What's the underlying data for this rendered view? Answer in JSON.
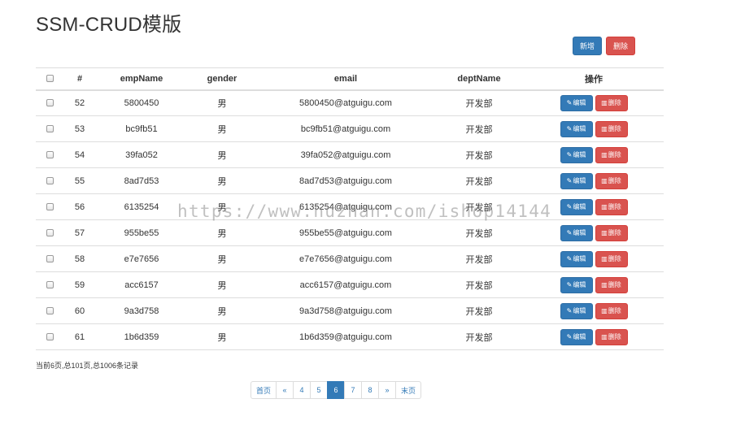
{
  "page": {
    "title": "SSM-CRUD模版"
  },
  "top_actions": {
    "add_label": "新增",
    "delete_label": "删除"
  },
  "table": {
    "headers": {
      "id": "#",
      "empName": "empName",
      "gender": "gender",
      "email": "email",
      "deptName": "deptName",
      "ops": "操作"
    },
    "edit_label": "编辑",
    "delete_label": "删除",
    "rows": [
      {
        "id": "52",
        "empName": "5800450",
        "gender": "男",
        "email": "5800450@atguigu.com",
        "deptName": "开发部"
      },
      {
        "id": "53",
        "empName": "bc9fb51",
        "gender": "男",
        "email": "bc9fb51@atguigu.com",
        "deptName": "开发部"
      },
      {
        "id": "54",
        "empName": "39fa052",
        "gender": "男",
        "email": "39fa052@atguigu.com",
        "deptName": "开发部"
      },
      {
        "id": "55",
        "empName": "8ad7d53",
        "gender": "男",
        "email": "8ad7d53@atguigu.com",
        "deptName": "开发部"
      },
      {
        "id": "56",
        "empName": "6135254",
        "gender": "男",
        "email": "6135254@atguigu.com",
        "deptName": "开发部"
      },
      {
        "id": "57",
        "empName": "955be55",
        "gender": "男",
        "email": "955be55@atguigu.com",
        "deptName": "开发部"
      },
      {
        "id": "58",
        "empName": "e7e7656",
        "gender": "男",
        "email": "e7e7656@atguigu.com",
        "deptName": "开发部"
      },
      {
        "id": "59",
        "empName": "acc6157",
        "gender": "男",
        "email": "acc6157@atguigu.com",
        "deptName": "开发部"
      },
      {
        "id": "60",
        "empName": "9a3d758",
        "gender": "男",
        "email": "9a3d758@atguigu.com",
        "deptName": "开发部"
      },
      {
        "id": "61",
        "empName": "1b6d359",
        "gender": "男",
        "email": "1b6d359@atguigu.com",
        "deptName": "开发部"
      }
    ]
  },
  "page_info": "当前6页,总101页,总1006条记录",
  "pagination": {
    "first": "首页",
    "prev": "«",
    "pages": [
      "4",
      "5",
      "6",
      "7",
      "8"
    ],
    "current": "6",
    "next": "»",
    "last": "末页"
  },
  "watermark": "https://www.huzhan.com/ishop14144",
  "colors": {
    "primary": "#337ab7",
    "danger": "#d9534f",
    "border": "#dddddd"
  },
  "icons": {
    "edit": "pencil-icon",
    "delete": "trash-icon"
  }
}
